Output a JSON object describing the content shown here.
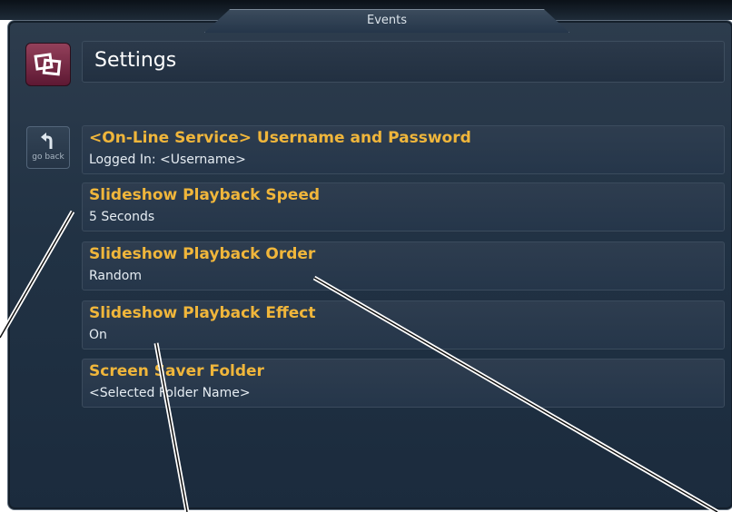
{
  "window": {
    "tab_title": "Events"
  },
  "header": {
    "title": "Settings",
    "app_icon": "slideshow-frames-icon"
  },
  "nav": {
    "back_label": "go back",
    "back_icon": "back-arrow-icon"
  },
  "settings": [
    {
      "title": "<On-Line Service> Username and Password",
      "value": "Logged In: <Username>"
    },
    {
      "title": "Slideshow Playback Speed",
      "value": "5 Seconds"
    },
    {
      "title": "Slideshow Playback Order",
      "value": "Random"
    },
    {
      "title": "Slideshow Playback Effect",
      "value": "On"
    },
    {
      "title": "Screen Saver Folder",
      "value": "<Selected Folder Name>"
    }
  ],
  "colors": {
    "accent_title": "#f0b63b",
    "value_text": "#e6edf3",
    "panel_bg": "#213244",
    "app_icon_bg": "#7a2745"
  }
}
